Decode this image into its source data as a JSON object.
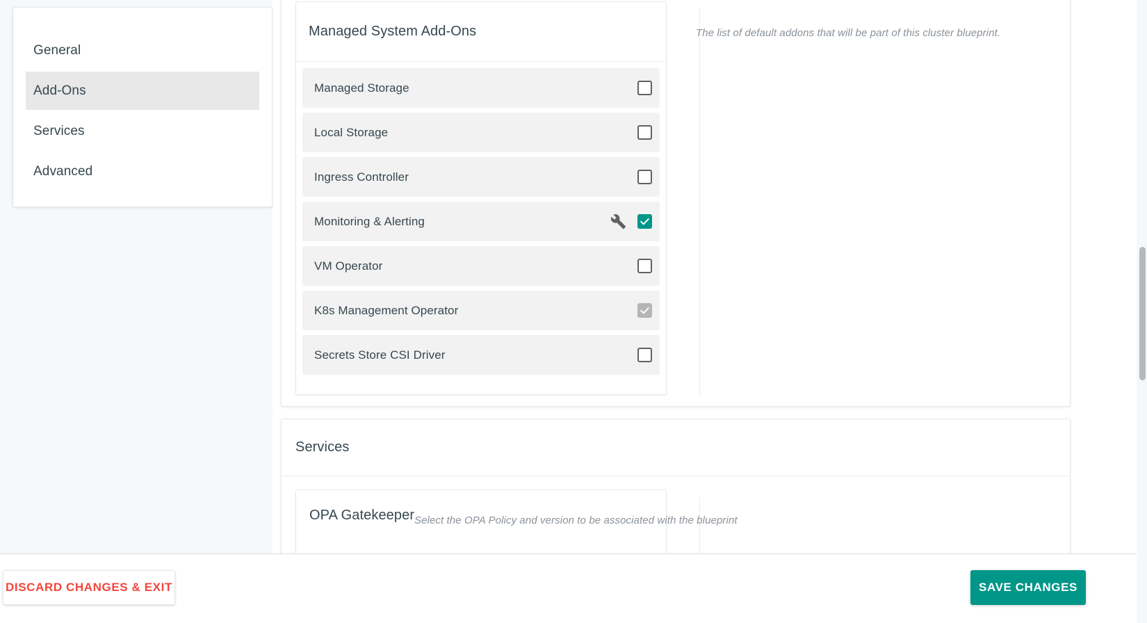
{
  "sidebar": {
    "items": [
      {
        "label": "General",
        "active": false
      },
      {
        "label": "Add-Ons",
        "active": true
      },
      {
        "label": "Services",
        "active": false
      },
      {
        "label": "Advanced",
        "active": false
      }
    ]
  },
  "addons_section": {
    "card_title": "Managed System Add-Ons",
    "helper_text": "The list of default addons that will be part of this cluster blueprint.",
    "rows": [
      {
        "label": "Managed Storage",
        "checked": false,
        "disabled": false,
        "config_icon": null
      },
      {
        "label": "Local Storage",
        "checked": false,
        "disabled": false,
        "config_icon": null
      },
      {
        "label": "Ingress Controller",
        "checked": false,
        "disabled": false,
        "config_icon": null
      },
      {
        "label": "Monitoring & Alerting",
        "checked": true,
        "disabled": false,
        "config_icon": "wrench-icon"
      },
      {
        "label": "VM Operator",
        "checked": false,
        "disabled": false,
        "config_icon": null
      },
      {
        "label": "K8s Management Operator",
        "checked": true,
        "disabled": true,
        "config_icon": null
      },
      {
        "label": "Secrets Store CSI Driver",
        "checked": false,
        "disabled": false,
        "config_icon": null
      }
    ]
  },
  "services_section": {
    "title": "Services",
    "opa_card_title": "OPA Gatekeeper",
    "helper_text": "Select the OPA Policy and version to be associated with the blueprint"
  },
  "action_bar": {
    "discard_label": "DISCARD CHANGES & EXIT",
    "save_label": "SAVE CHANGES"
  },
  "colors": {
    "accent_teal": "#009688",
    "danger_red": "#f4453c",
    "row_background": "#f2f2f2",
    "active_nav": "#e8e8e8",
    "disabled_check": "#b5b5b5",
    "wrench_gray": "#616161"
  }
}
